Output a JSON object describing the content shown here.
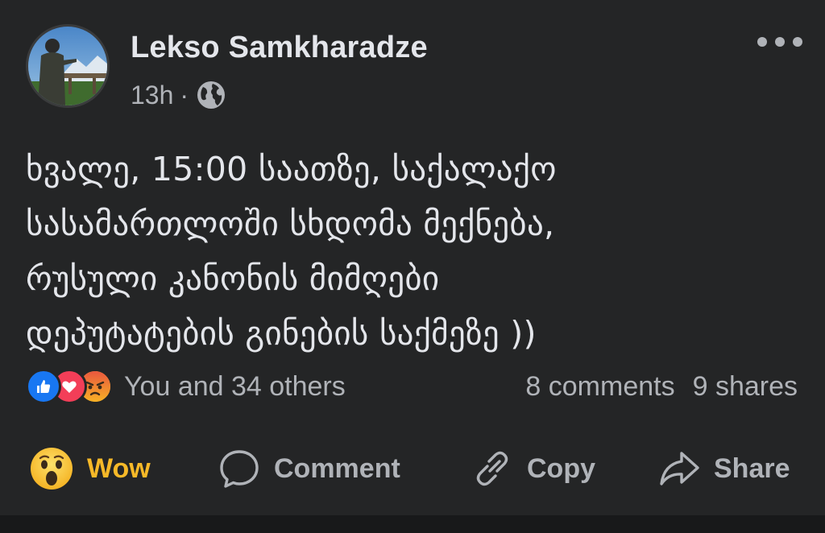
{
  "post": {
    "author": "Lekso Samkharadze",
    "time": "13h",
    "separator": "·",
    "privacy_icon": "globe-icon",
    "text_lines": [
      "ხვალე, 15:00 საათზე, საქალაქო",
      "სასამართლოში სხდომა მექნება,",
      "რუსული კანონის მიმღები",
      "დეპუტატების გინების საქმეზე ))"
    ]
  },
  "reactions": {
    "icons": [
      "like-icon",
      "love-icon",
      "angry-icon"
    ],
    "summary": "You and 34 others",
    "comments": "8 comments",
    "shares": "9 shares"
  },
  "actions": {
    "reaction_label": "Wow",
    "comment_label": "Comment",
    "copy_label": "Copy",
    "share_label": "Share"
  },
  "colors": {
    "background": "#242526",
    "text_primary": "#e4e6eb",
    "text_secondary": "#b0b3b8",
    "wow_accent": "#f7b928",
    "like_blue": "#1877f2",
    "love_red": "#f33e58"
  }
}
